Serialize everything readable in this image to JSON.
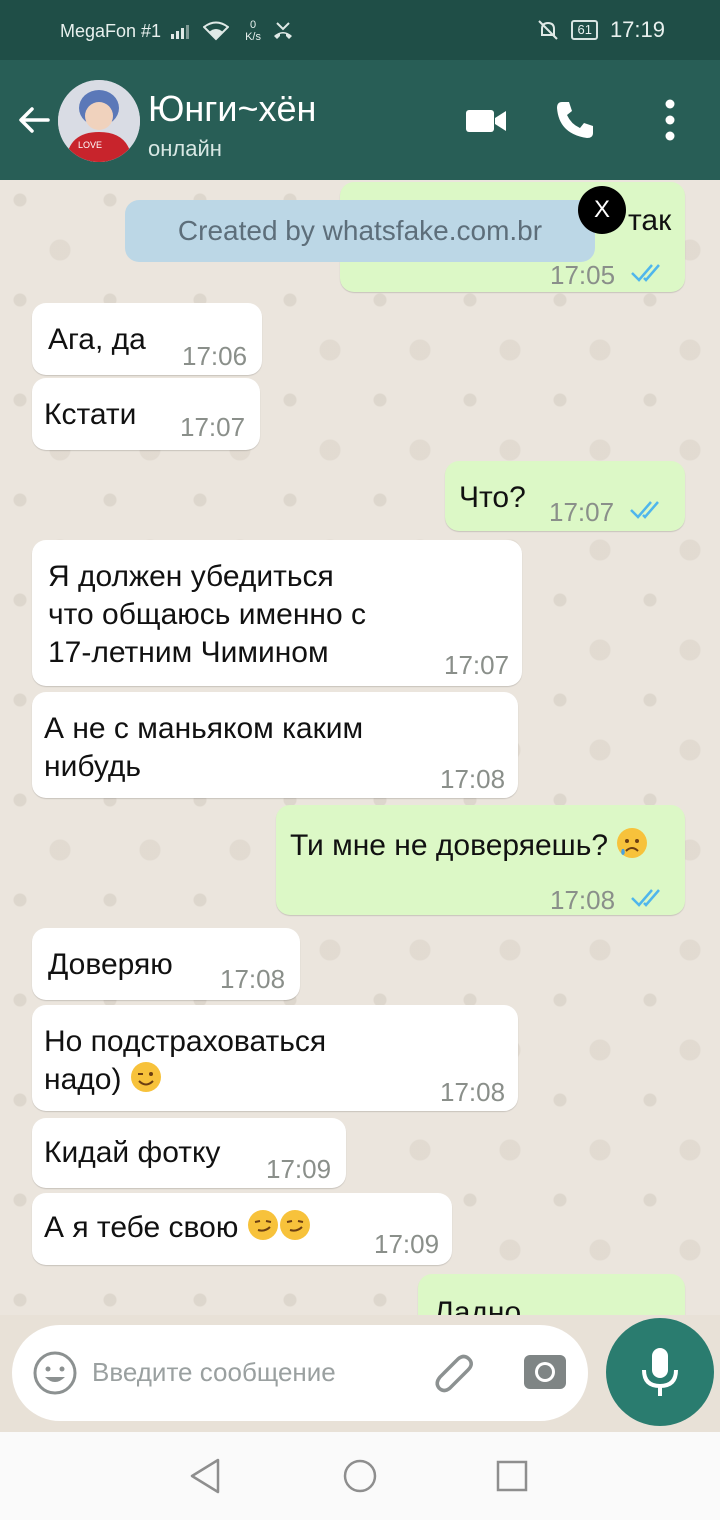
{
  "status_bar": {
    "carrier": "MegaFon #1",
    "net_speed_value": "0",
    "net_speed_unit": "K/s",
    "battery": "61",
    "time": "17:19"
  },
  "header": {
    "contact_name": "Юнги~хён",
    "contact_status": "онлайн"
  },
  "watermark": {
    "text": "Created by whatsfake.com.br",
    "close": "X"
  },
  "messages": [
    {
      "dir": "out",
      "text": "так",
      "time": "17:05",
      "ticks": "read"
    },
    {
      "dir": "in",
      "text": "Ага, да",
      "time": "17:06"
    },
    {
      "dir": "in",
      "text": "Кстати",
      "time": "17:07"
    },
    {
      "dir": "out",
      "text": "Что?",
      "time": "17:07",
      "ticks": "read"
    },
    {
      "dir": "in",
      "text": "Я должен убедиться\nчто общаюсь именно с\n17-летним Чимином",
      "time": "17:07"
    },
    {
      "dir": "in",
      "text": "А не с маньяком каким\nнибудь",
      "time": "17:08"
    },
    {
      "dir": "out",
      "text": "Ти мне не доверяешь?",
      "time": "17:08",
      "ticks": "read",
      "emoji": "sad-face"
    },
    {
      "dir": "in",
      "text": "Доверяю",
      "time": "17:08"
    },
    {
      "dir": "in",
      "text": "Но подстраховаться\nнадо)",
      "time": "17:08",
      "emoji": "wink-face"
    },
    {
      "dir": "in",
      "text": "Кидай фотку",
      "time": "17:09"
    },
    {
      "dir": "in",
      "text": "А я тебе свою",
      "time": "17:09",
      "emoji": "smirk-face x2"
    },
    {
      "dir": "out",
      "text": "Ладно",
      "time": ""
    }
  ],
  "input": {
    "placeholder": "Введите сообщение"
  },
  "colors": {
    "header": "#285e56",
    "status_bar": "#1f4e47",
    "outgoing_bubble": "#dcf8c6",
    "incoming_bubble": "#ffffff",
    "mic_button": "#2a7c6f",
    "read_ticks": "#4fb6ec"
  }
}
